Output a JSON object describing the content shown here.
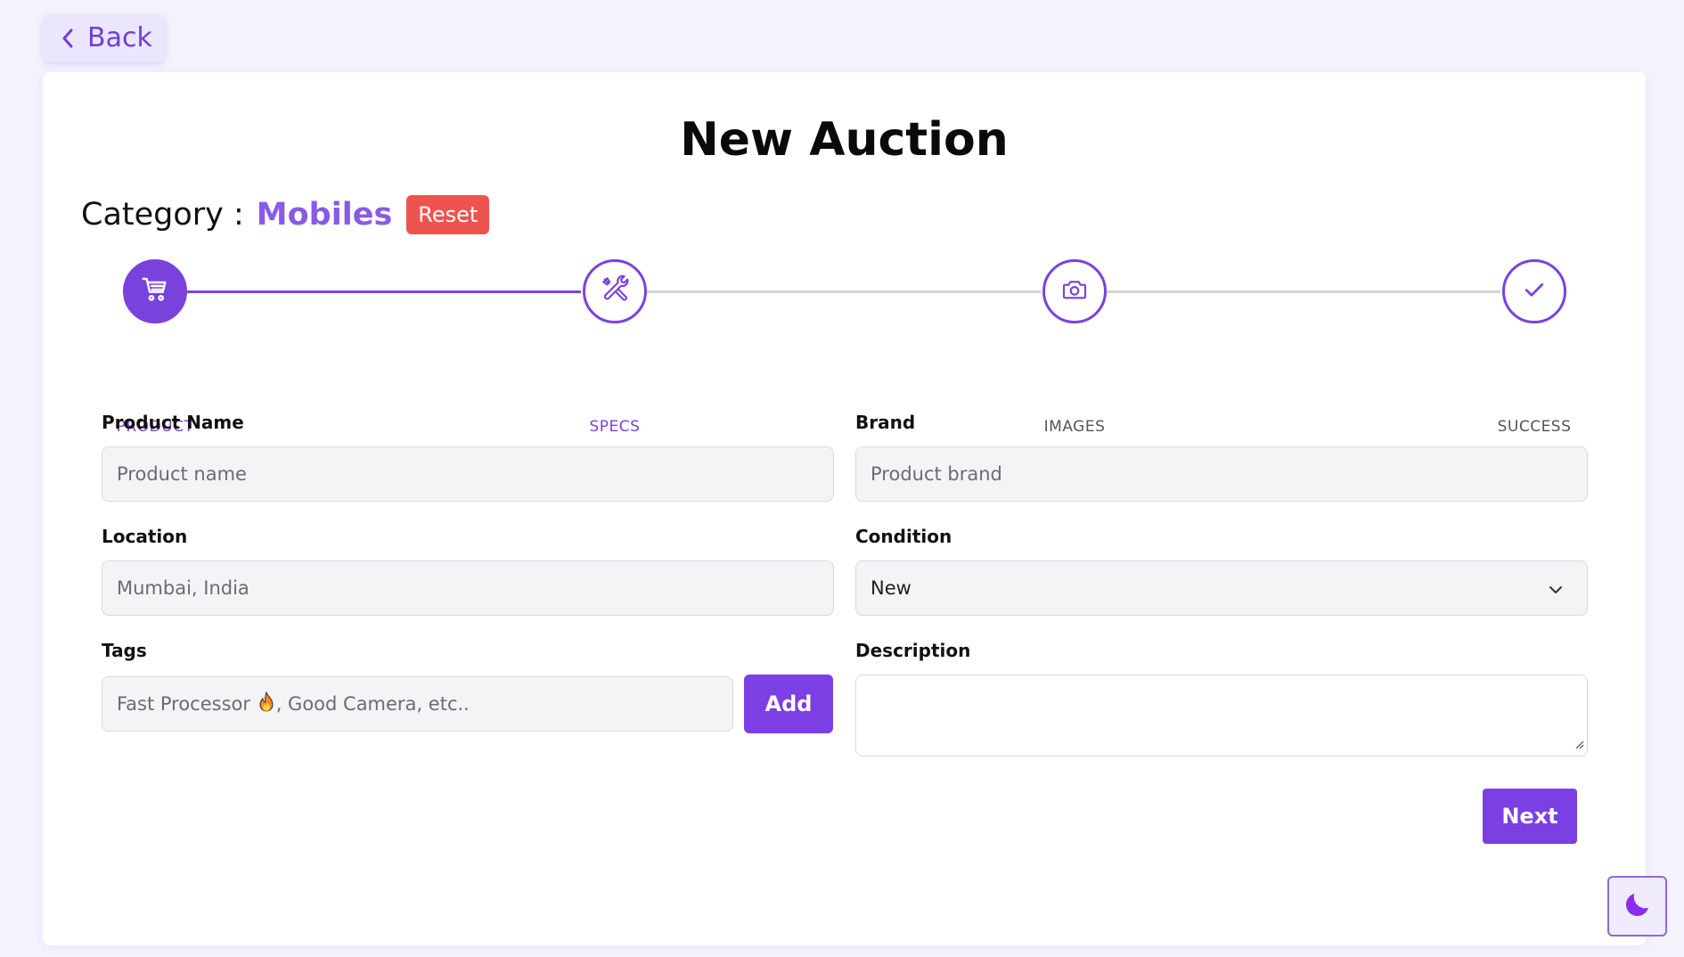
{
  "nav": {
    "back_label": "Back"
  },
  "page": {
    "title": "New Auction",
    "category_label": "Category :",
    "category_value": "Mobiles",
    "reset_label": "Reset"
  },
  "stepper": {
    "steps": [
      {
        "label": "PRODUCT",
        "icon": "cart-icon",
        "state": "active"
      },
      {
        "label": "SPECS",
        "icon": "tools-icon",
        "state": "reached"
      },
      {
        "label": "IMAGES",
        "icon": "camera-icon",
        "state": "pending"
      },
      {
        "label": "SUCCESS",
        "icon": "check-icon",
        "state": "pending"
      }
    ]
  },
  "form": {
    "product_name": {
      "label": "Product Name",
      "placeholder": "Product name"
    },
    "brand": {
      "label": "Brand",
      "placeholder": "Product brand"
    },
    "location": {
      "label": "Location",
      "placeholder": "Mumbai, India"
    },
    "condition": {
      "label": "Condition",
      "value": "New"
    },
    "tags": {
      "label": "Tags",
      "placeholder_before": "Fast Processor ",
      "placeholder_after": ", Good Camera, etc..",
      "add_label": "Add"
    },
    "description": {
      "label": "Description",
      "value": ""
    },
    "next_label": "Next"
  },
  "theme": {
    "icon": "moon-icon"
  },
  "colors": {
    "accent": "#7b3fe4",
    "accent_light": "#8a5ae6",
    "reset": "#ef5350",
    "background": "#f4f2fd"
  }
}
